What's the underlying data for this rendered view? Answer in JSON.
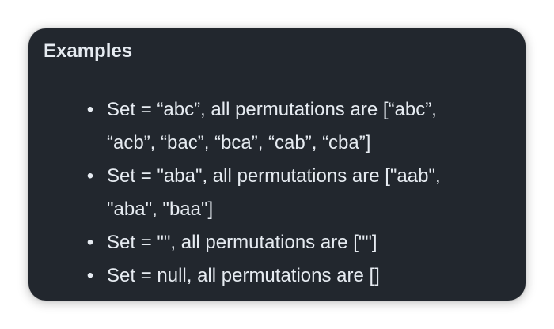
{
  "section": {
    "title": "Examples"
  },
  "items": [
    {
      "line1": "Set = “abc”, all permutations are [“abc”,",
      "line2": "“acb”, “bac”, “bca”, “cab”, “cba”]"
    },
    {
      "line1": "Set = \"aba\", all permutations are [\"aab\",",
      "line2": "\"aba\", \"baa\"]"
    },
    {
      "line1": "Set = \"\", all permutations are [\"\"]",
      "line2": ""
    },
    {
      "line1": "Set = null, all permutations are []",
      "line2": ""
    }
  ]
}
